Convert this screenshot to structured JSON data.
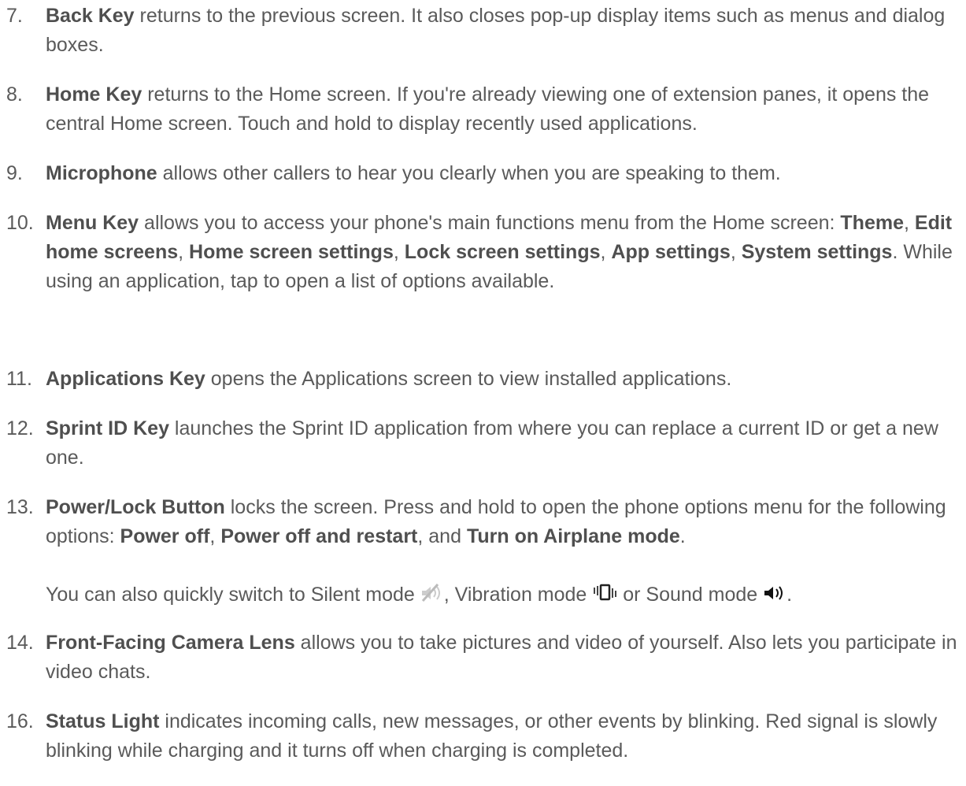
{
  "items": [
    {
      "num": "7.",
      "lead": "Back Key",
      "text": " returns to the previous screen. It also closes pop-up display items such as menus and dialog boxes."
    },
    {
      "num": "8.",
      "lead": "Home Key",
      "text": " returns to the Home screen. If you're already viewing one of extension panes, it opens the central Home screen. Touch and hold to display recently used applications."
    },
    {
      "num": "9.",
      "lead": "Microphone",
      "text": " allows other callers to hear you clearly when you are speaking to them."
    },
    {
      "num": "10.",
      "lead": "Menu Key",
      "text": " allows you to access your phone's main functions menu from the Home screen: ",
      "opts": [
        "Theme",
        "Edit home screens",
        "Home screen settings",
        "Lock screen settings",
        "App settings",
        "System settings"
      ],
      "tail": ". While using an application, tap to open a list of options available."
    },
    {
      "num": "11.",
      "lead": "Applications Key",
      "text": " opens the Applications screen to view installed applications."
    },
    {
      "num": "12.",
      "lead": "Sprint ID Key",
      "text": " launches the Sprint ID application from where you can replace a current ID or get a new one."
    },
    {
      "num": "13.",
      "lead": "Power/Lock Button",
      "text": " locks the screen. Press and hold to open the phone options menu for the following options: ",
      "opts": [
        "Power off",
        "Power off and restart",
        "Turn on Airplane mode"
      ],
      "tail": ".",
      "note": {
        "a": "You can also quickly switch to Silent mode ",
        "b": ", Vibration mode ",
        "c": " or Sound mode ",
        "d": "."
      }
    },
    {
      "num": "14.",
      "lead": "Front-Facing Camera Lens",
      "text": " allows you to take pictures and video of yourself. Also lets you participate in video chats."
    },
    {
      "num": "16.",
      "lead": "Status Light",
      "text": " indicates incoming calls, new messages, or other events by blinking. Red signal is slowly blinking while charging and it turns off when charging is completed."
    }
  ],
  "seps": {
    "comma": ", ",
    "and": ", and "
  },
  "icons": {
    "silent": "silent-mode-icon",
    "vibration": "vibration-mode-icon",
    "sound": "sound-mode-icon"
  },
  "colors": {
    "text": "#5a5a5a",
    "bold": "#4f4f4f"
  }
}
